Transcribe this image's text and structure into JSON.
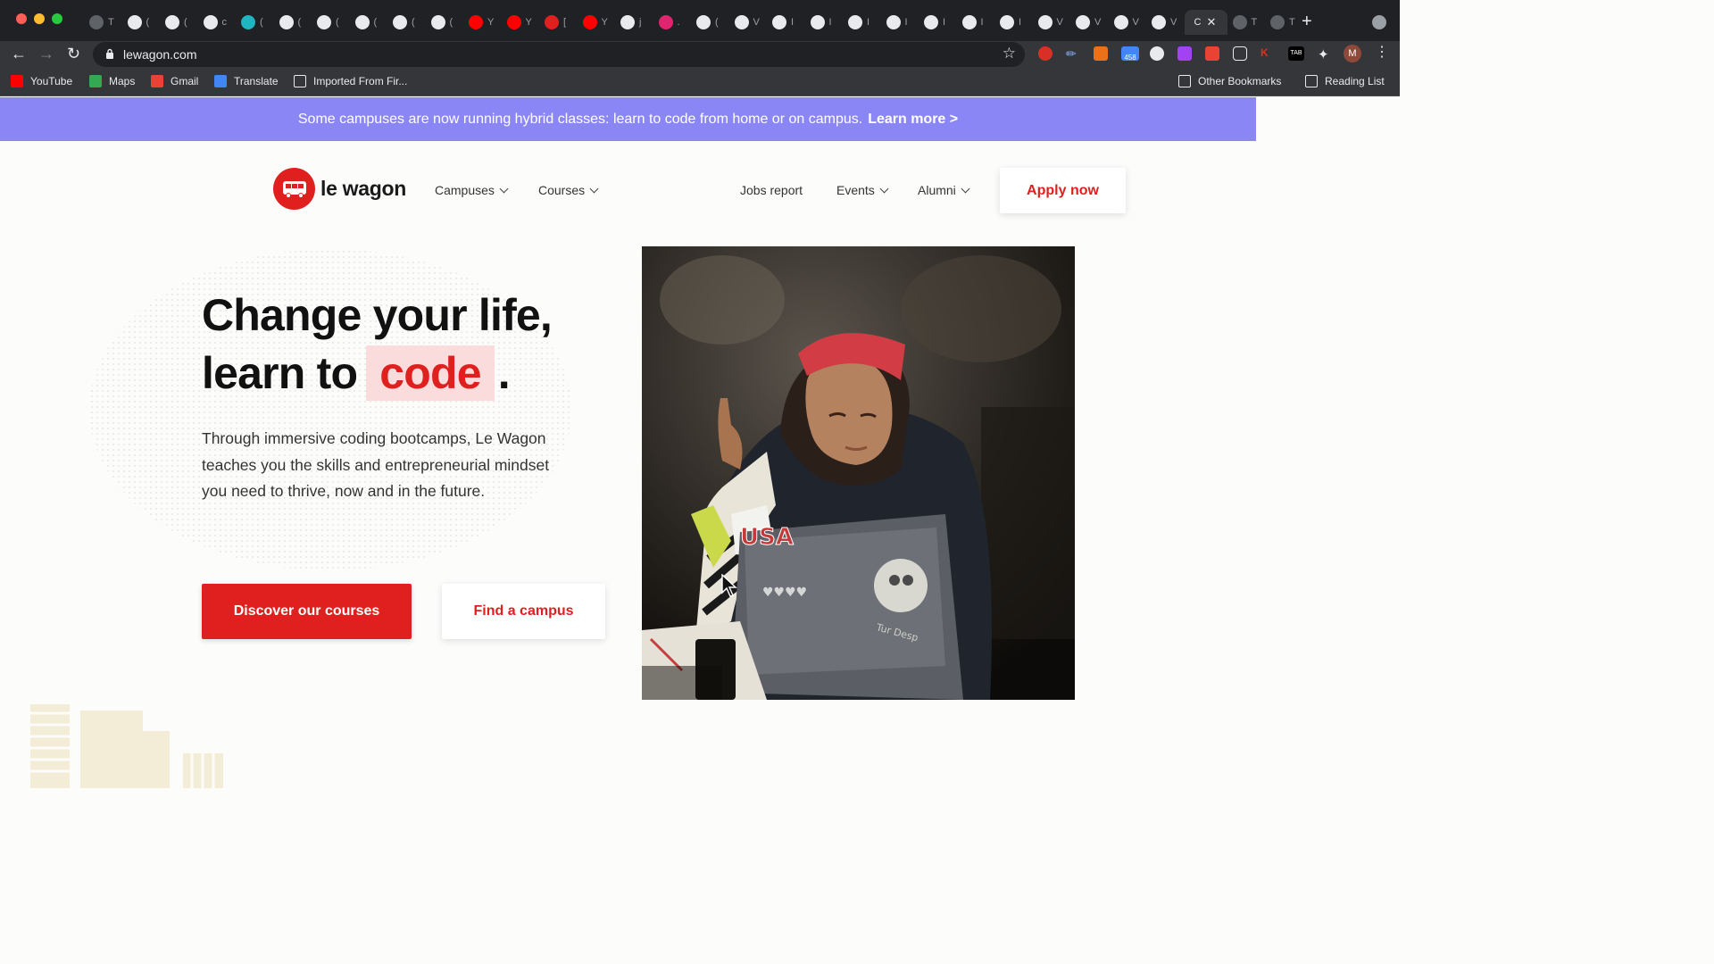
{
  "browser": {
    "tabs": [
      {
        "icon": "globe-icon",
        "label": "T",
        "color": "#5f6368"
      },
      {
        "icon": "github-icon",
        "label": "(",
        "color": "#e8eaed"
      },
      {
        "icon": "google-icon",
        "label": "(",
        "color": "#e8eaed"
      },
      {
        "icon": "google-icon",
        "label": "c",
        "color": "#e8eaed"
      },
      {
        "icon": "circle-icon",
        "label": "(",
        "color": "#1fb6c1"
      },
      {
        "icon": "github-icon",
        "label": "(",
        "color": "#e8eaed"
      },
      {
        "icon": "github-icon",
        "label": "(",
        "color": "#e8eaed"
      },
      {
        "icon": "github-icon",
        "label": "(",
        "color": "#e8eaed"
      },
      {
        "icon": "github-icon",
        "label": "(",
        "color": "#e8eaed"
      },
      {
        "icon": "github-icon",
        "label": "(",
        "color": "#e8eaed"
      },
      {
        "icon": "youtube-icon",
        "label": "Y",
        "color": "#ff0000"
      },
      {
        "icon": "youtube-icon",
        "label": "Y",
        "color": "#ff0000"
      },
      {
        "icon": "bus-icon",
        "label": "[",
        "color": "#e0201f"
      },
      {
        "icon": "youtube-icon",
        "label": "Y",
        "color": "#ff0000"
      },
      {
        "icon": "google-icon",
        "label": "j",
        "color": "#e8eaed"
      },
      {
        "icon": "record-icon",
        "label": ".",
        "color": "#e0246f"
      },
      {
        "icon": "google-icon",
        "label": "(",
        "color": "#e8eaed"
      },
      {
        "icon": "google-icon",
        "label": "V",
        "color": "#e8eaed"
      },
      {
        "icon": "medium-icon",
        "label": "I",
        "color": "#e8eaed"
      },
      {
        "icon": "medium-icon",
        "label": "I",
        "color": "#e8eaed"
      },
      {
        "icon": "medium-icon",
        "label": "I",
        "color": "#e8eaed"
      },
      {
        "icon": "medium-icon",
        "label": "I",
        "color": "#e8eaed"
      },
      {
        "icon": "medium-icon",
        "label": "I",
        "color": "#e8eaed"
      },
      {
        "icon": "medium-icon",
        "label": "I",
        "color": "#e8eaed"
      },
      {
        "icon": "medium-icon",
        "label": "I",
        "color": "#e8eaed"
      },
      {
        "icon": "wikipedia-icon",
        "label": "V",
        "color": "#e8eaed"
      },
      {
        "icon": "wikipedia-icon",
        "label": "V",
        "color": "#e8eaed"
      },
      {
        "icon": "wikipedia-icon",
        "label": "V",
        "color": "#e8eaed"
      },
      {
        "icon": "wikipedia-icon",
        "label": "V",
        "color": "#e8eaed"
      }
    ],
    "active_tab": {
      "label": "C",
      "close": "✕"
    },
    "trailing_tabs": [
      {
        "icon": "globe-icon",
        "label": "T"
      },
      {
        "icon": "globe-icon",
        "label": "T"
      }
    ],
    "new_tab": "+",
    "url": "lewagon.com",
    "bookmarks": [
      {
        "label": "YouTube",
        "icon": "youtube-icon",
        "color": "#ff0000"
      },
      {
        "label": "Maps",
        "icon": "maps-icon",
        "color": "#34a853"
      },
      {
        "label": "Gmail",
        "icon": "gmail-icon",
        "color": "#ea4335"
      },
      {
        "label": "Translate",
        "icon": "translate-icon",
        "color": "#4285f4"
      },
      {
        "label": "Imported From Fir...",
        "icon": "folder-icon",
        "color": "#e8eaed"
      }
    ],
    "other_bookmarks": "Other Bookmarks",
    "reading_list": "Reading List",
    "extension_badge": "458",
    "profile_initial": "M",
    "extension_tab_label": "TAB",
    "extension_k_label": "K"
  },
  "banner": {
    "text": "Some campuses are now running hybrid classes: learn to code from home or on campus.",
    "link": "Learn more >"
  },
  "header": {
    "logo_text": "le wagon",
    "nav": {
      "campuses": "Campuses",
      "courses": "Courses",
      "jobs_report": "Jobs report",
      "events": "Events",
      "alumni": "Alumni"
    },
    "apply": "Apply now"
  },
  "hero": {
    "line1": "Change your life,",
    "line2_prefix": "learn to",
    "highlight": "code",
    "line2_suffix": ".",
    "lead": "Through immersive coding bootcamps, Le Wagon teaches you the skills and entrepreneurial mindset you need to thrive, now and in the future.",
    "primary_cta": "Discover our courses",
    "secondary_cta": "Find a campus",
    "photo_shirt_text": "USA",
    "photo_hearts": "♥♥♥♥",
    "photo_sticker_text": "Tur Desp"
  },
  "colors": {
    "brand_red": "#e01f1f",
    "banner_purple": "#8b86f5",
    "highlight_pink": "#fbdcdc",
    "chrome_dark": "#202124",
    "chrome_toolbar": "#35363a"
  }
}
